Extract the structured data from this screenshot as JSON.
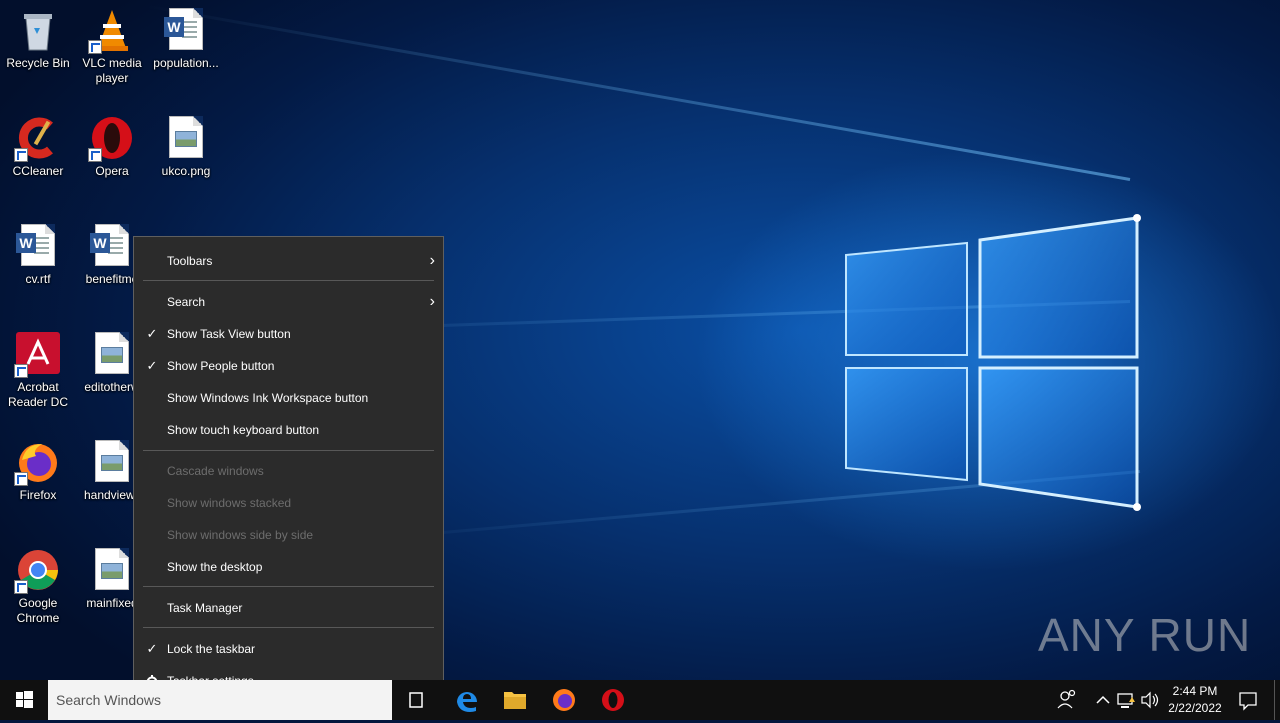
{
  "desktop_icons": [
    {
      "id": "recycle-bin",
      "label": "Recycle Bin",
      "icon": "recycle-bin-icon"
    },
    {
      "id": "vlc",
      "label": "VLC media player",
      "icon": "vlc-icon"
    },
    {
      "id": "population",
      "label": "population...",
      "icon": "word-document-icon"
    },
    {
      "id": "ccleaner",
      "label": "CCleaner",
      "icon": "ccleaner-icon"
    },
    {
      "id": "opera",
      "label": "Opera",
      "icon": "opera-icon"
    },
    {
      "id": "ukco",
      "label": "ukco.png",
      "icon": "image-file-icon"
    },
    {
      "id": "cv",
      "label": "cv.rtf",
      "icon": "word-document-icon"
    },
    {
      "id": "benefitme",
      "label": "benefitme",
      "icon": "word-document-icon"
    },
    {
      "id": "acrobat",
      "label": "Acrobat Reader DC",
      "icon": "acrobat-icon"
    },
    {
      "id": "editother",
      "label": "editotherw",
      "icon": "image-file-icon"
    },
    {
      "id": "firefox",
      "label": "Firefox",
      "icon": "firefox-icon"
    },
    {
      "id": "handview",
      "label": "handview.j",
      "icon": "image-file-icon"
    },
    {
      "id": "chrome",
      "label": "Google Chrome",
      "icon": "chrome-icon"
    },
    {
      "id": "mainfixed",
      "label": "mainfixed",
      "icon": "image-file-icon"
    }
  ],
  "context_menu": {
    "items": [
      {
        "label": "Toolbars",
        "checked": false,
        "submenu": true,
        "enabled": true
      },
      {
        "label": "Search",
        "checked": false,
        "submenu": true,
        "enabled": true
      },
      {
        "label": "Show Task View button",
        "checked": true,
        "enabled": true
      },
      {
        "label": "Show People button",
        "checked": true,
        "enabled": true
      },
      {
        "label": "Show Windows Ink Workspace button",
        "checked": false,
        "enabled": true
      },
      {
        "label": "Show touch keyboard button",
        "checked": false,
        "enabled": true
      },
      {
        "label": "Cascade windows",
        "checked": false,
        "enabled": false
      },
      {
        "label": "Show windows stacked",
        "checked": false,
        "enabled": false
      },
      {
        "label": "Show windows side by side",
        "checked": false,
        "enabled": false
      },
      {
        "label": "Show the desktop",
        "checked": false,
        "enabled": true
      },
      {
        "label": "Task Manager",
        "checked": false,
        "enabled": true
      },
      {
        "label": "Lock the taskbar",
        "checked": true,
        "enabled": true
      },
      {
        "label": "Taskbar settings",
        "checked": false,
        "enabled": true,
        "icon": "gear-icon"
      }
    ]
  },
  "taskbar": {
    "search_placeholder": "Search Windows",
    "apps": [
      "edge-icon",
      "file-explorer-icon",
      "firefox-icon",
      "opera-icon"
    ],
    "clock_time": "2:44 PM",
    "clock_date": "2/22/2022"
  },
  "watermark": "ANY RUN",
  "colors": {
    "menu_bg": "#2b2b2b",
    "menu_disabled": "#6d6d6d",
    "taskbar_bg": "#101010",
    "accent": "#0a4fa5"
  }
}
